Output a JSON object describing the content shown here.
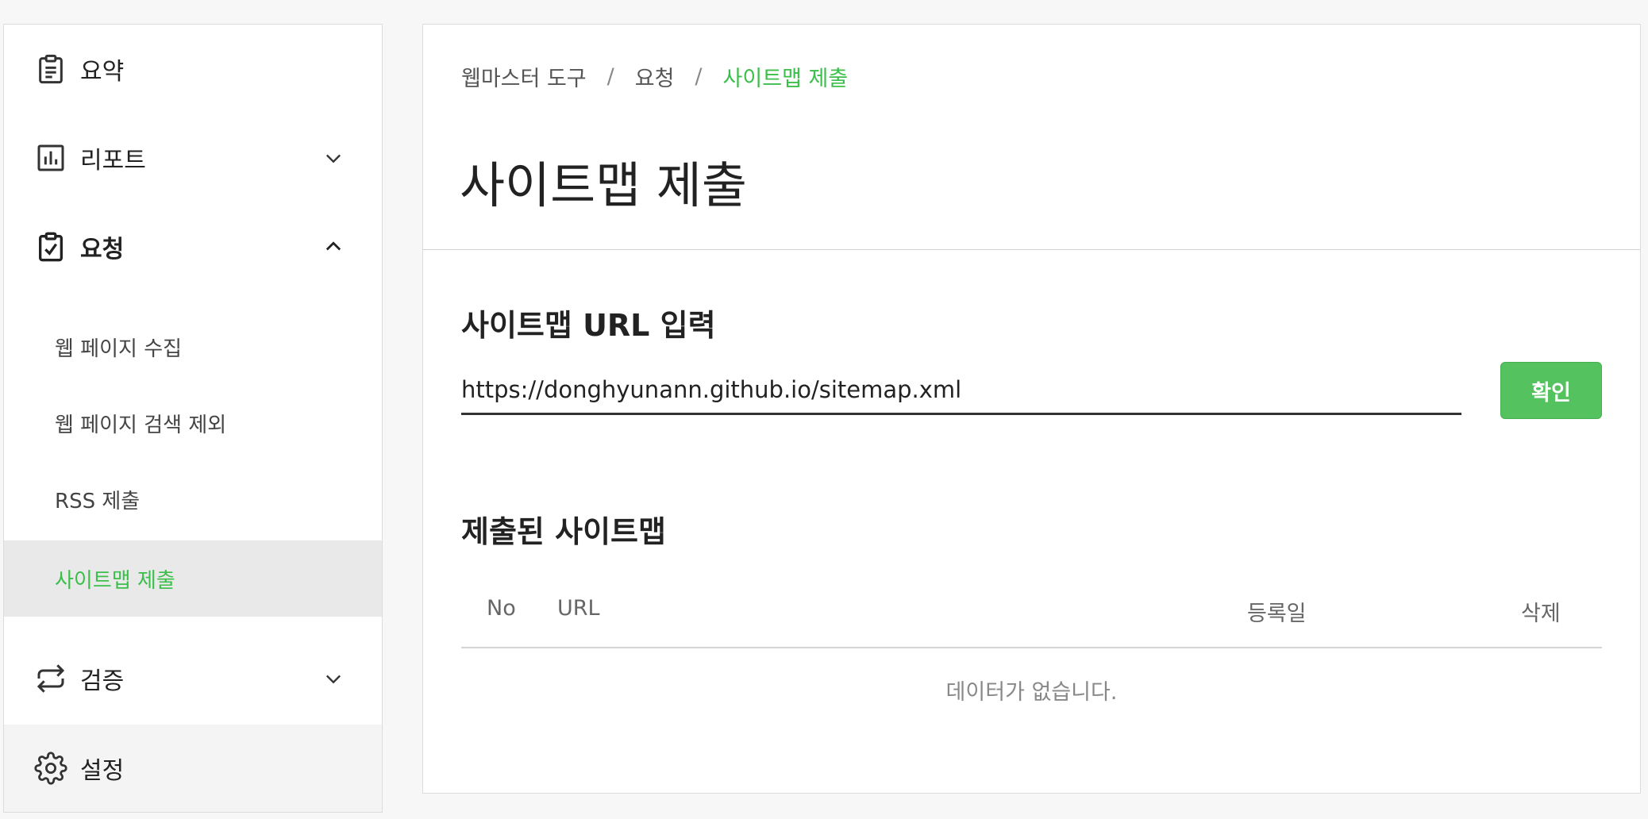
{
  "sidebar": {
    "items": [
      {
        "label": "요약"
      },
      {
        "label": "리포트"
      },
      {
        "label": "요청"
      },
      {
        "label": "검증"
      },
      {
        "label": "설정"
      }
    ],
    "sub_items": [
      {
        "label": "웹 페이지 수집"
      },
      {
        "label": "웹 페이지 검색 제외"
      },
      {
        "label": "RSS 제출"
      },
      {
        "label": "사이트맵 제출"
      }
    ]
  },
  "breadcrumb": {
    "root": "웹마스터 도구",
    "parent": "요청",
    "current": "사이트맵 제출",
    "separator": "/"
  },
  "page_title": "사이트맵 제출",
  "url_section": {
    "title": "사이트맵 URL 입력",
    "input_value": "https://donghyunann.github.io/sitemap.xml",
    "confirm_label": "확인"
  },
  "submitted": {
    "title": "제출된 사이트맵",
    "columns": {
      "no": "No",
      "url": "URL",
      "date": "등록일",
      "delete": "삭제"
    },
    "empty_message": "데이터가 없습니다."
  },
  "colors": {
    "accent": "#3bbf4a",
    "button": "#54c25f"
  },
  "icons": [
    "clipboard-icon",
    "bar-chart-icon",
    "clipboard-check-icon",
    "sync-arrows-icon",
    "gear-icon",
    "chevron-down-icon",
    "chevron-up-icon"
  ]
}
